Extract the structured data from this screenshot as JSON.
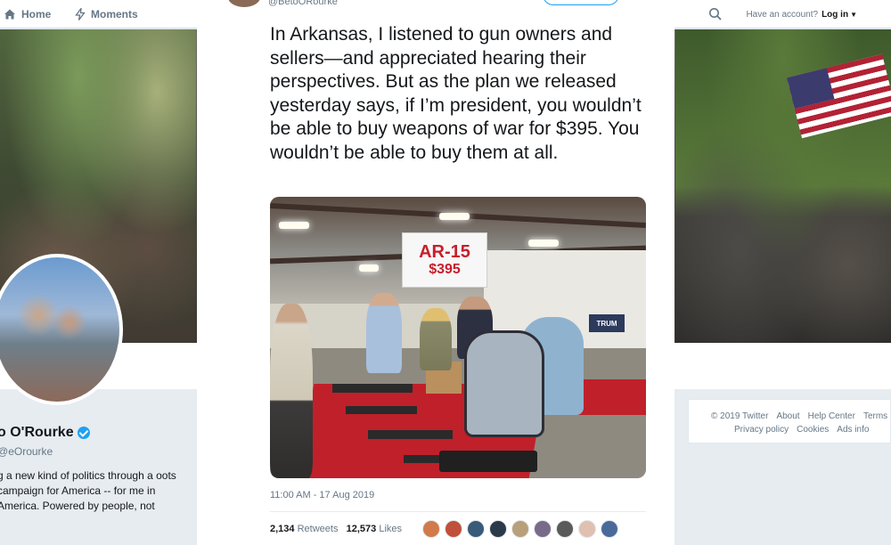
{
  "nav": {
    "home_label": "Home",
    "moments_label": "Moments",
    "account_prompt": "Have an account?",
    "login_label": "Log in"
  },
  "profile": {
    "name": "o O'Rourke",
    "handle": "eOrourke",
    "bio": "g a new kind of politics through a oots campaign for America -- for me in America. Powered by people, not"
  },
  "tweet": {
    "handle": "@BetoORourke",
    "text": "In Arkansas, I listened to gun owners and sellers—and appreciated hearing their perspectives. But as the plan we released yesterday says, if I’m president, you wouldn’t be able to buy weapons of war for $395. You wouldn’t be able to buy them at all.",
    "photo": {
      "sign_line1": "AR-15",
      "sign_line2": "$395",
      "banner": "TRUM"
    },
    "timestamp": "11:00 AM - 17 Aug 2019",
    "retweets_count": "2,134",
    "retweets_label": "Retweets",
    "likes_count": "12,573",
    "likes_label": "Likes"
  },
  "footer": {
    "copyright": "© 2019 Twitter",
    "about": "About",
    "help_center": "Help Center",
    "terms": "Terms",
    "privacy": "Privacy policy",
    "cookies": "Cookies",
    "ads_info": "Ads info"
  },
  "colors": {
    "twitter_blue": "#1da1f2",
    "sign_red": "#c81e2a",
    "table_red": "#c0202a"
  },
  "icons": {
    "home": "home-icon",
    "moments": "lightning-icon",
    "search": "search-icon",
    "verified": "verified-badge-icon"
  }
}
